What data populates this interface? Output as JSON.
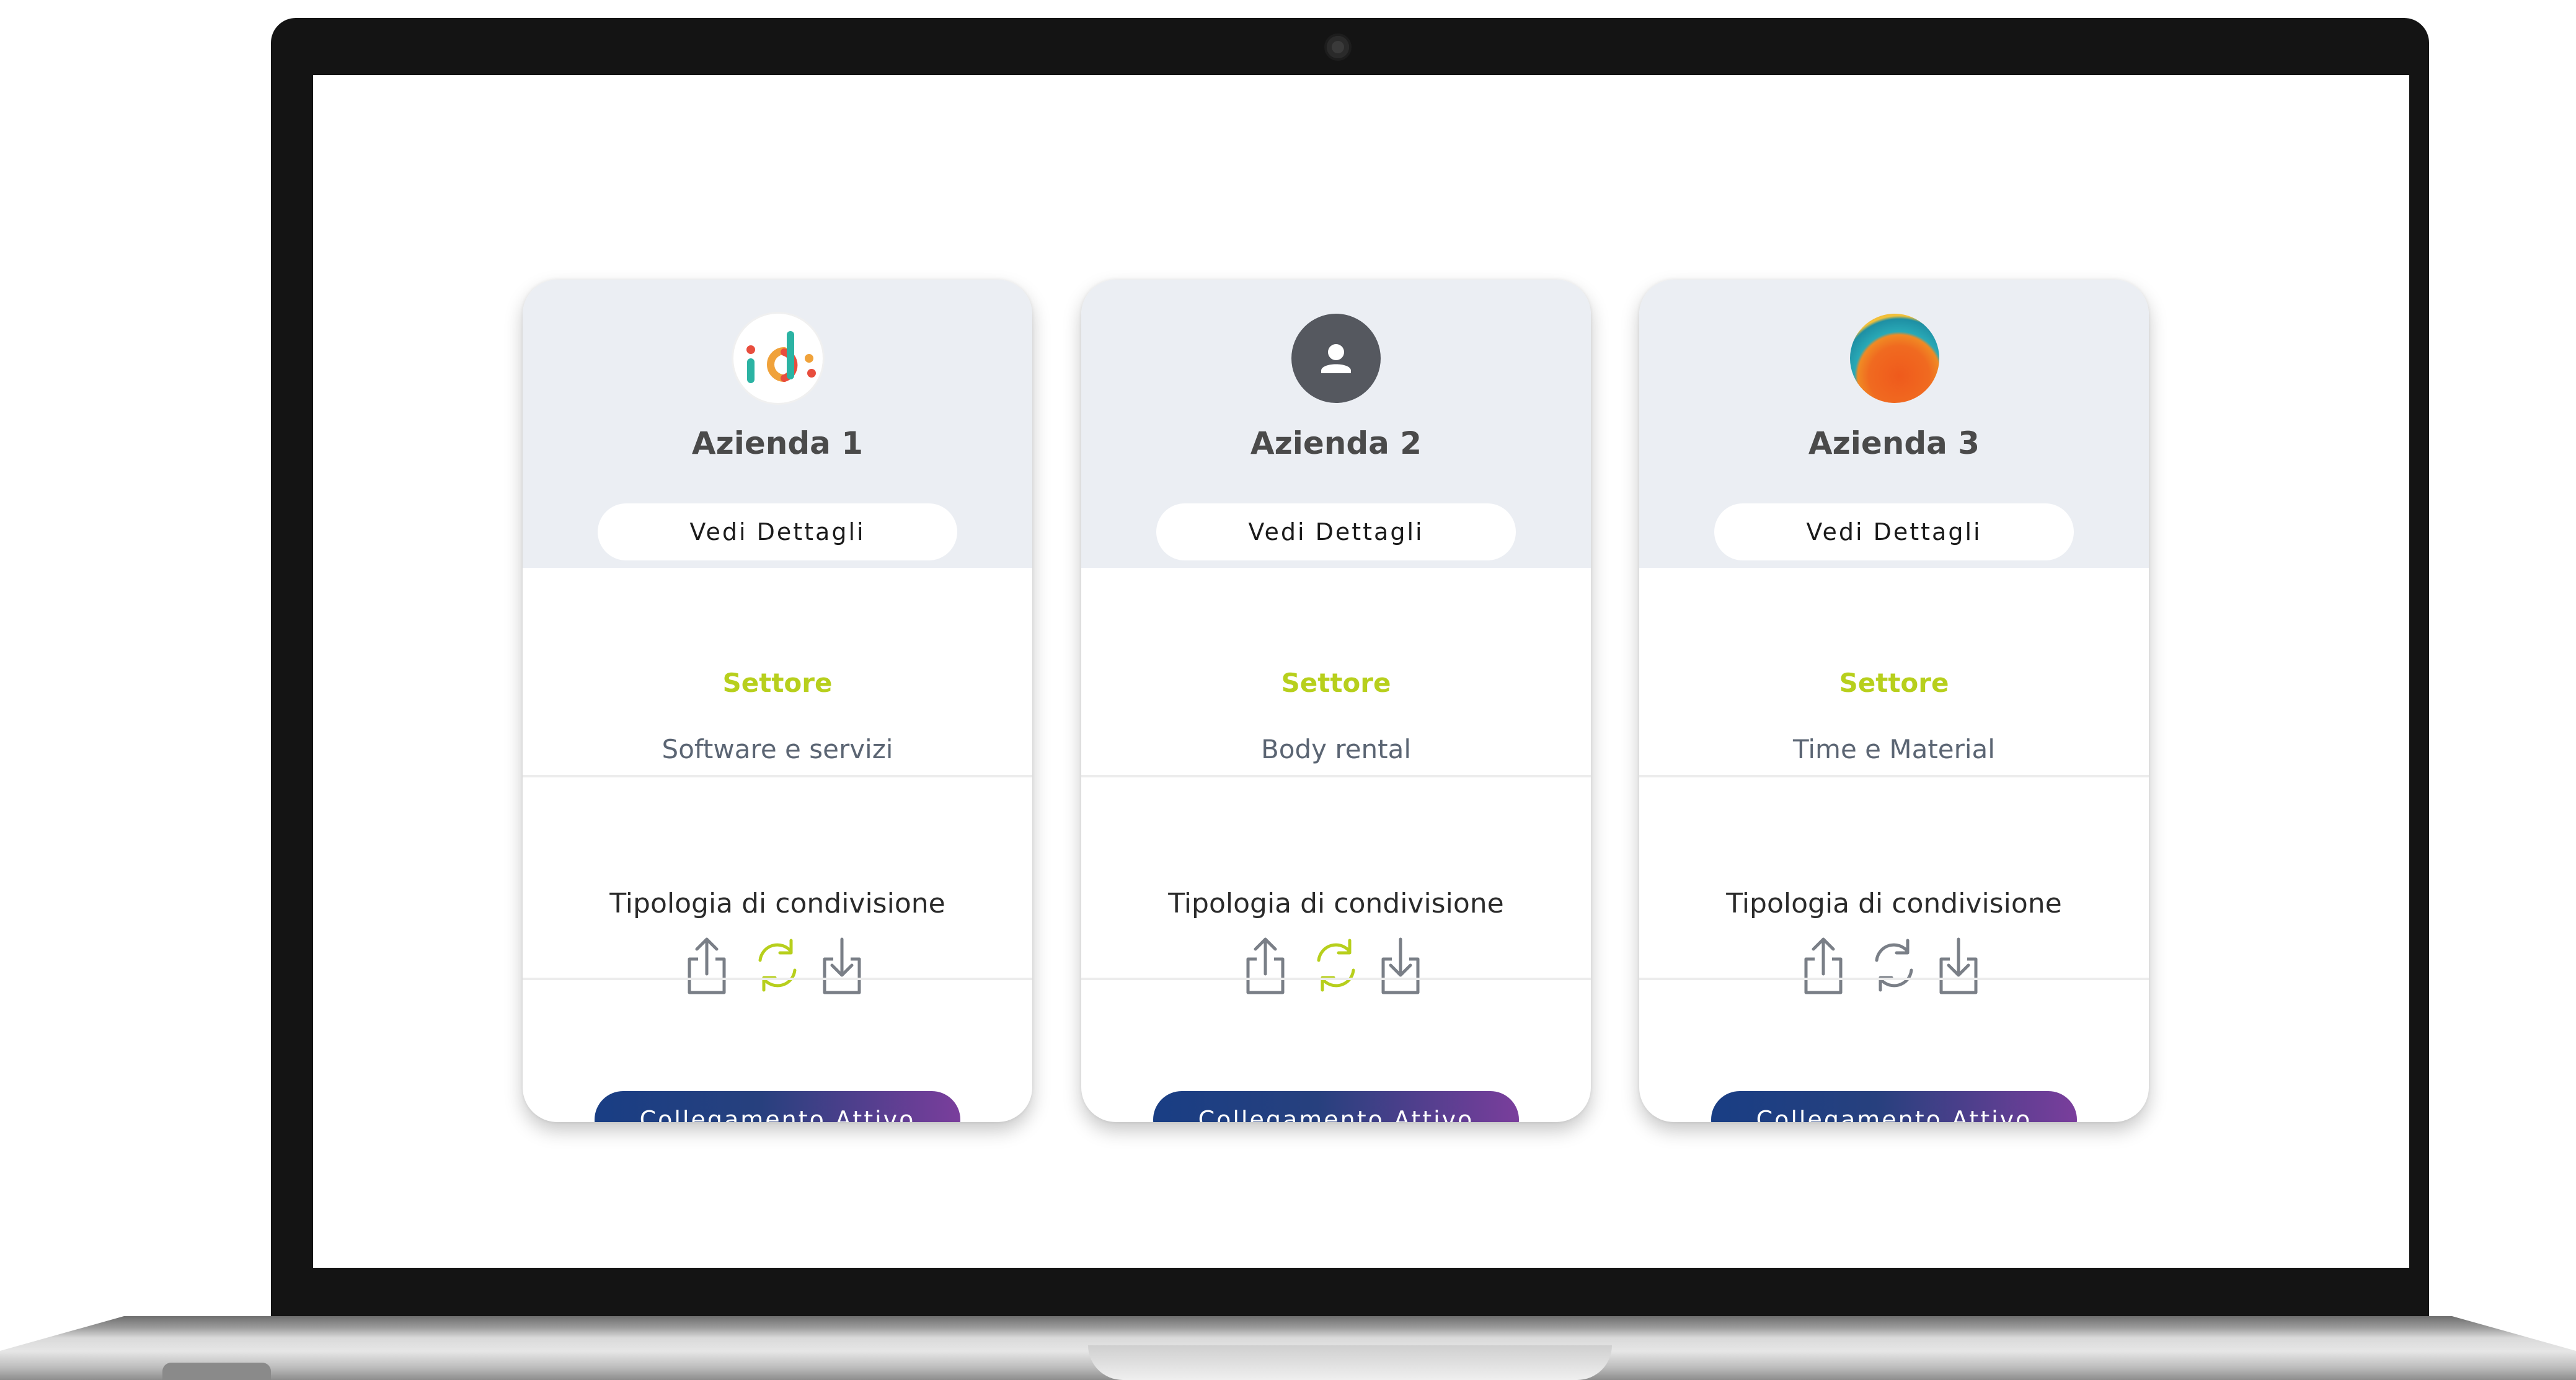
{
  "cards": [
    {
      "name": "Azienda 1",
      "avatar_icon": "ids-logo-icon",
      "details_label": "Vedi Dettagli",
      "sector_label": "Settore",
      "sector_value": "Software e servizi",
      "sharing_label": "Tipologia di condivisione",
      "sync_active": true,
      "connection_label": "Collegamento Attivo"
    },
    {
      "name": "Azienda 2",
      "avatar_icon": "user-placeholder-icon",
      "details_label": "Vedi Dettagli",
      "sector_label": "Settore",
      "sector_value": "Body rental",
      "sharing_label": "Tipologia di condivisione",
      "sync_active": true,
      "connection_label": "Collegamento Attivo"
    },
    {
      "name": "Azienda 3",
      "avatar_icon": "abstract-blob-logo-icon",
      "details_label": "Vedi Dettagli",
      "sector_label": "Settore",
      "sector_value": "Time e Material",
      "sharing_label": "Tipologia di condivisione",
      "sync_active": false,
      "connection_label": "Collegamento Attivo"
    }
  ],
  "colors": {
    "sector_label": "#b7cf1c",
    "sync_active": "#b7cf1c",
    "sync_inactive": "#7a7f87",
    "icon_gray": "#7a7f87",
    "header_bg": "#ebeef3",
    "button_gradient_start": "#193e84",
    "button_gradient_end": "#7a3e9c"
  }
}
